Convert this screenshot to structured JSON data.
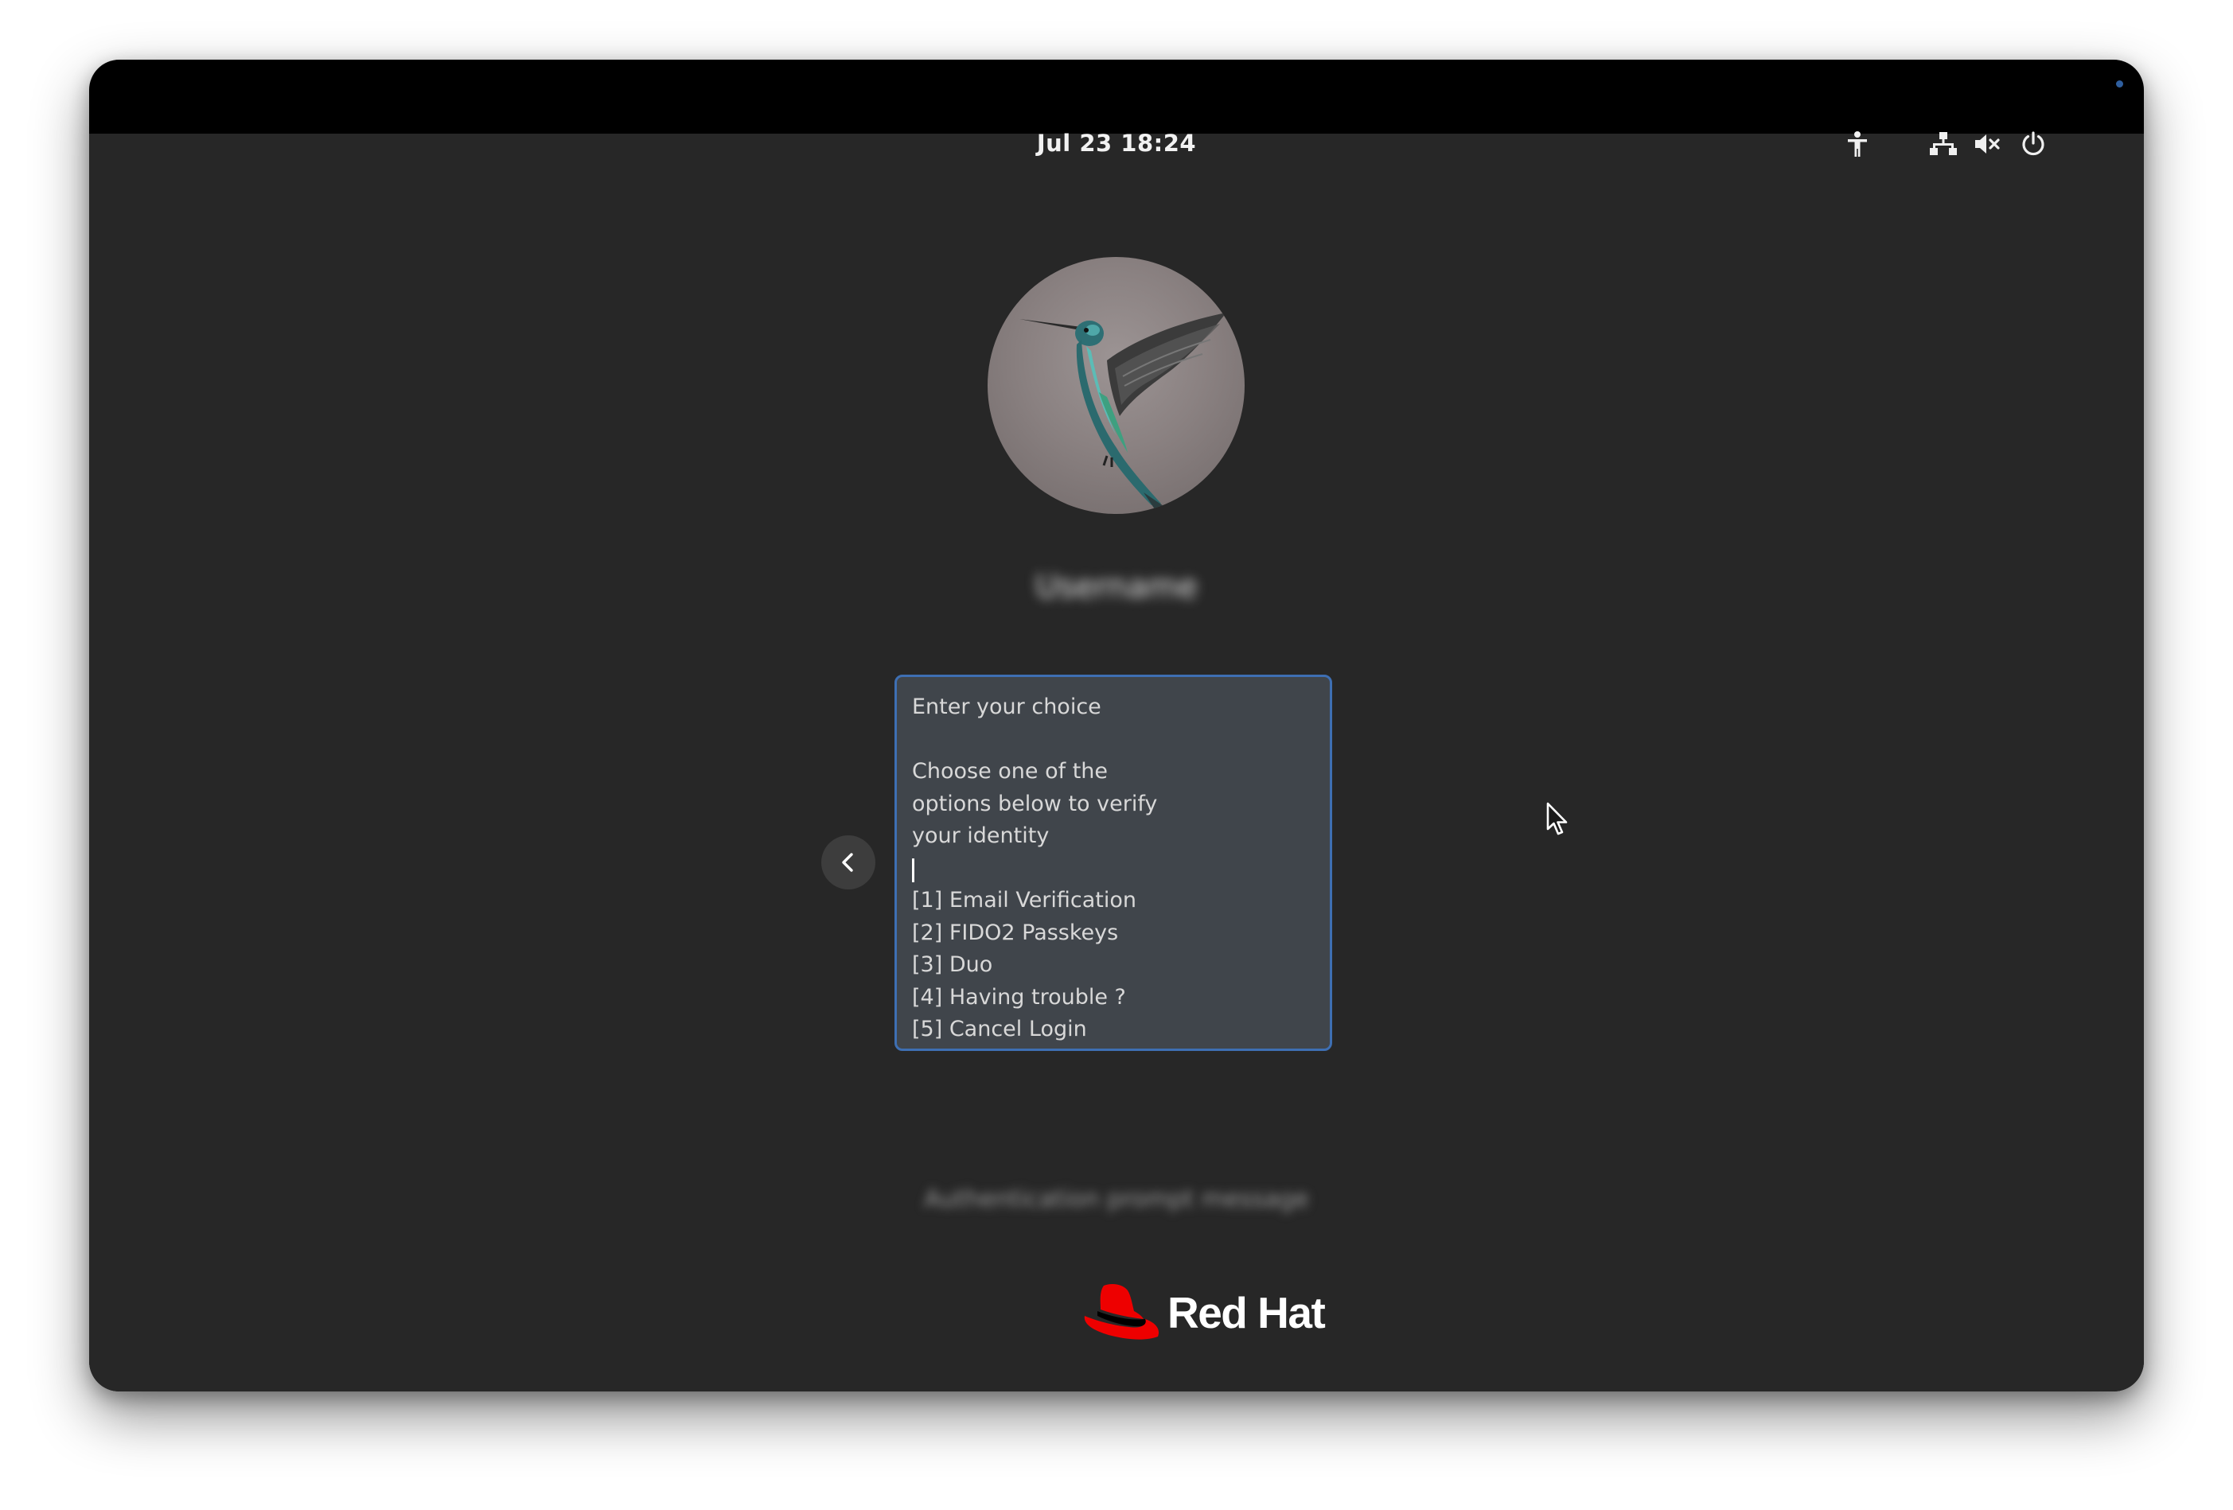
{
  "topbar": {
    "clock": "Jul 23  18:24",
    "tray_icons": [
      "accessibility-icon",
      "network-icon",
      "volume-muted-icon",
      "power-icon"
    ]
  },
  "user": {
    "avatar": "hummingbird photo",
    "name": "Username"
  },
  "prompt": {
    "lines": [
      "Enter your choice",
      "",
      "Choose one of the",
      "options below to verify",
      "your identity",
      "",
      "[1] Email Verification",
      "[2] FIDO2 Passkeys",
      "[3] Duo",
      "[4] Having trouble ?",
      "[5] Cancel Login"
    ]
  },
  "hint": "Authentication prompt message",
  "logo": {
    "text": "Red Hat",
    "brand_color": "#ee0000"
  },
  "colors": {
    "background": "#272727",
    "focus_border": "#3e6fb3",
    "prompt_bg": "#40454b"
  }
}
